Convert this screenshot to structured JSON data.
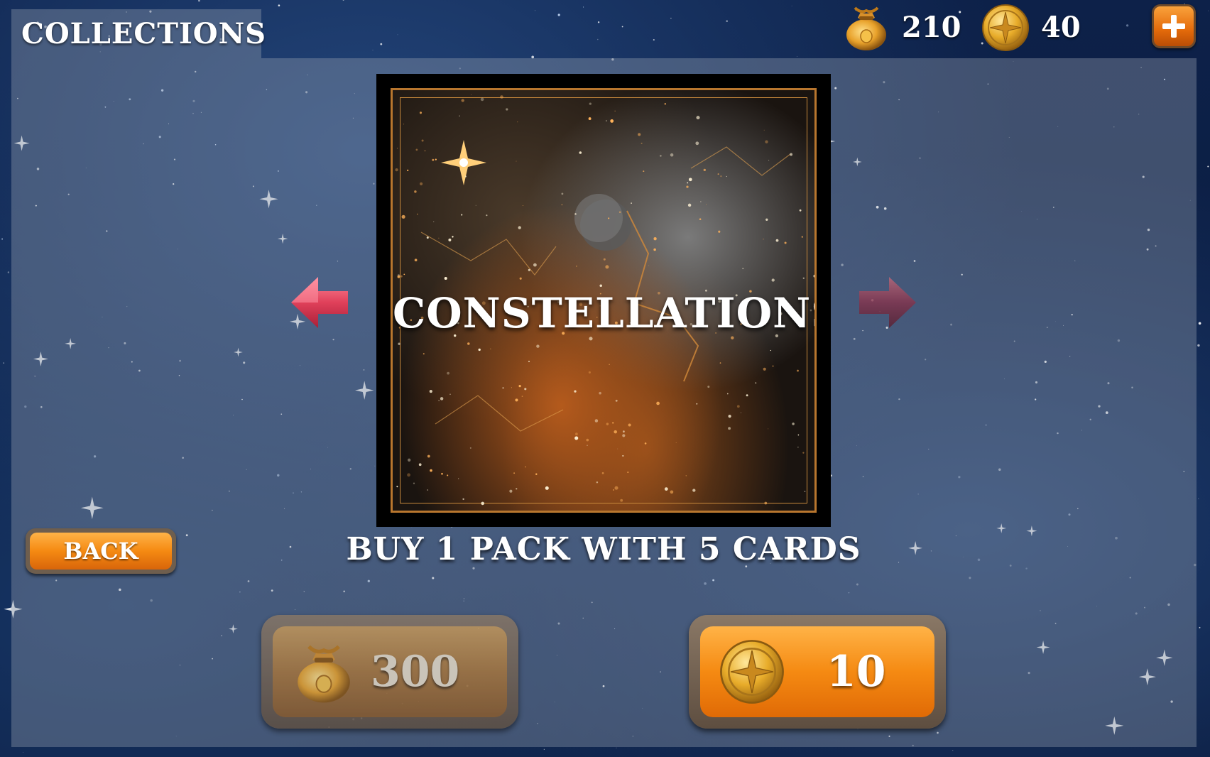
{
  "header": {
    "title": "COLLECTIONS"
  },
  "currencies": {
    "bags": {
      "icon": "money-bag-icon",
      "value": "210"
    },
    "coins": {
      "icon": "gold-coin-icon",
      "value": "40"
    },
    "add_icon": "plus-icon"
  },
  "collection": {
    "name": "CONSTELLATIONS",
    "prev_icon": "arrow-left-icon",
    "next_icon": "arrow-right-icon"
  },
  "offer": {
    "text": "BUY 1 PACK WITH 5 CARDS"
  },
  "buttons": {
    "back_label": "BACK",
    "buy_with_bags": {
      "icon": "money-bag-icon",
      "price": "300"
    },
    "buy_with_coins": {
      "icon": "gold-coin-icon",
      "price": "10"
    }
  },
  "colors": {
    "accent_orange": "#f58a12",
    "arrow_red": "#e0405a",
    "frame_gold": "#b8762e"
  }
}
